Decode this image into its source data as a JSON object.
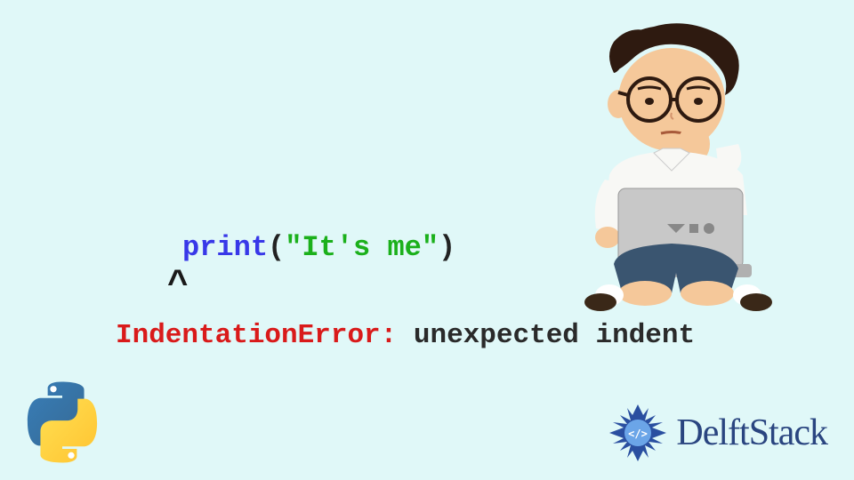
{
  "code": {
    "print_keyword": "print",
    "open_paren": "(",
    "string_literal": "\"It's me\"",
    "close_paren": ")",
    "caret": "^",
    "error_name": "IndentationError:",
    "error_message": " unexpected indent"
  },
  "brand": {
    "name": "DelftStack"
  }
}
